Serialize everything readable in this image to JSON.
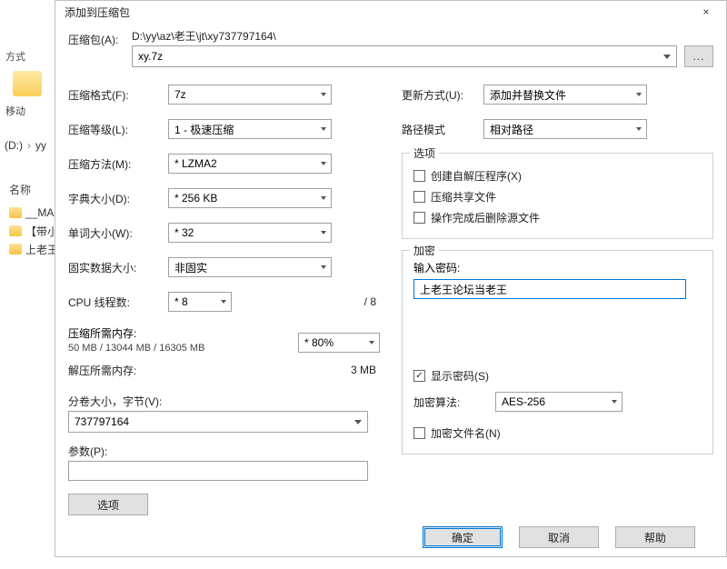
{
  "bg": {
    "shortcut_label": "方式",
    "move_label": "移动",
    "breadcrumb": [
      "(D:)",
      "yy"
    ],
    "name_header": "名称",
    "files": [
      "__MA",
      "【带小",
      "上老王"
    ]
  },
  "dialog": {
    "title": "添加到压缩包",
    "close": "×",
    "archive": {
      "label": "压缩包(A):",
      "path": "D:\\yy\\az\\老王\\jt\\xy737797164\\",
      "filename": "xy.7z",
      "browse": "..."
    },
    "left": {
      "format_label": "压缩格式(F):",
      "format_value": "7z",
      "level_label": "压缩等级(L):",
      "level_value": "1 - 极速压缩",
      "method_label": "压缩方法(M):",
      "method_value": "* LZMA2",
      "dict_label": "字典大小(D):",
      "dict_value": "* 256 KB",
      "word_label": "单词大小(W):",
      "word_value": "* 32",
      "solid_label": "固实数据大小:",
      "solid_value": "非固实",
      "cpu_label": "CPU 线程数:",
      "cpu_value": "* 8",
      "cpu_total": "/ 8",
      "mem_comp_label": "压缩所需内存:",
      "mem_comp_combo": "* 80%",
      "mem_comp_text": "50 MB / 13044 MB / 16305 MB",
      "mem_decomp_label": "解压所需内存:",
      "mem_decomp_value": "3 MB",
      "split_label": "分卷大小，字节(V):",
      "split_value": "737797164",
      "params_label": "参数(P):",
      "params_value": "",
      "options_btn": "选项"
    },
    "right": {
      "update_label": "更新方式(U):",
      "update_value": "添加并替换文件",
      "pathmode_label": "路径模式",
      "pathmode_value": "相对路径",
      "options_group": "选项",
      "opt_sfx": "创建自解压程序(X)",
      "opt_shared": "压缩共享文件",
      "opt_delete": "操作完成后删除源文件",
      "enc_group": "加密",
      "pw_label": "输入密码:",
      "pw_value": "上老王论坛当老王",
      "show_pw": "显示密码(S)",
      "show_pw_checked": true,
      "enc_method_label": "加密算法:",
      "enc_method_value": "AES-256",
      "enc_names": "加密文件名(N)"
    },
    "footer": {
      "ok": "确定",
      "cancel": "取消",
      "help": "帮助"
    }
  }
}
